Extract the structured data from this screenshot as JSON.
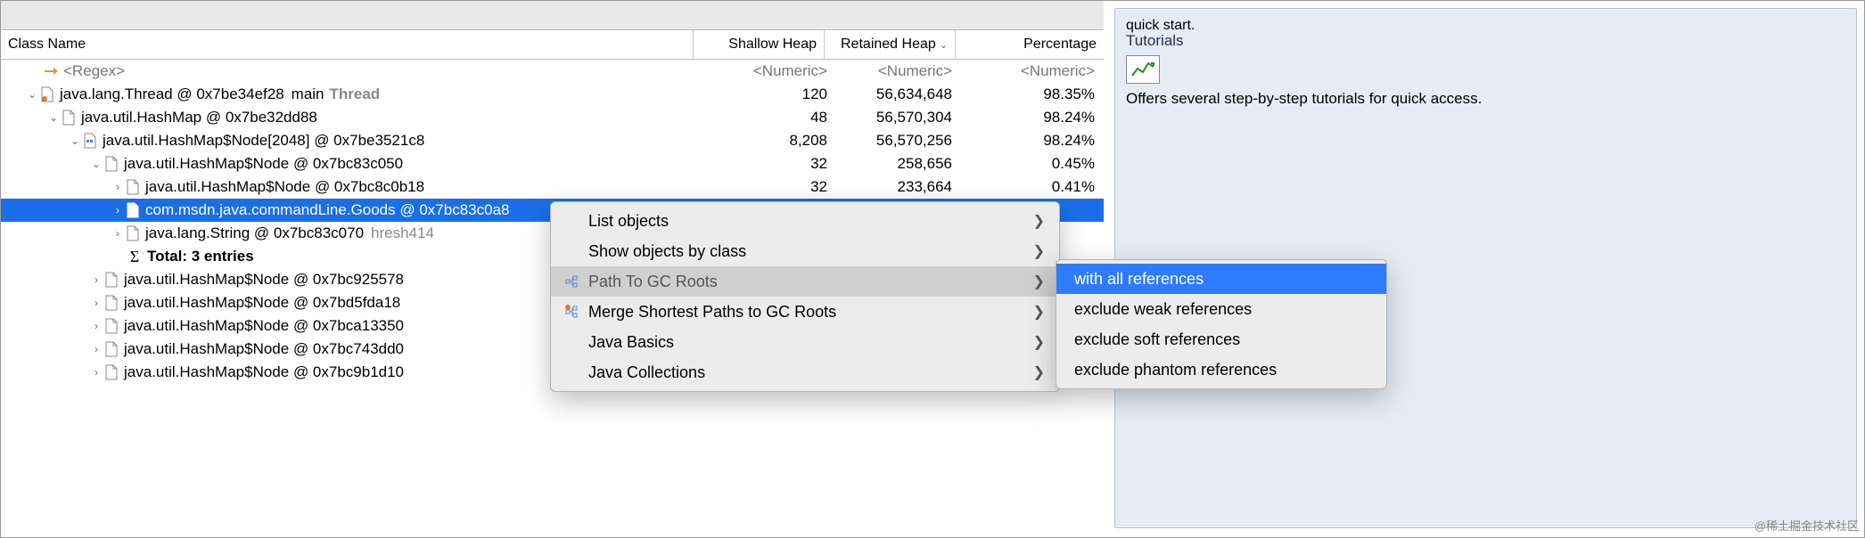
{
  "header": {
    "class_name": "Class Name",
    "shallow": "Shallow Heap",
    "retained": "Retained Heap",
    "percentage": "Percentage",
    "numeric_ph": "<Numeric>",
    "regex_ph": "<Regex>"
  },
  "rows": [
    {
      "indent": 0,
      "tw": "down",
      "icon": "thread",
      "name": "java.lang.Thread @ 0x7be34ef28",
      "extra": "main",
      "extra2": "Thread",
      "sh": "120",
      "rh": "56,634,648",
      "pct": "98.35%"
    },
    {
      "indent": 1,
      "tw": "down",
      "icon": "file",
      "name": "java.util.HashMap @ 0x7be32dd88",
      "sh": "48",
      "rh": "56,570,304",
      "pct": "98.24%"
    },
    {
      "indent": 2,
      "tw": "down",
      "icon": "arrfile",
      "name": "java.util.HashMap$Node[2048] @ 0x7be3521c8",
      "sh": "8,208",
      "rh": "56,570,256",
      "pct": "98.24%"
    },
    {
      "indent": 3,
      "tw": "down",
      "icon": "file",
      "name": "java.util.HashMap$Node @ 0x7bc83c050",
      "sh": "32",
      "rh": "258,656",
      "pct": "0.45%"
    },
    {
      "indent": 4,
      "tw": "right",
      "icon": "file",
      "name": "java.util.HashMap$Node @ 0x7bc8c0b18",
      "sh": "32",
      "rh": "233,664",
      "pct": "0.41%"
    },
    {
      "indent": 4,
      "tw": "right",
      "icon": "file",
      "name": "com.msdn.java.commandLine.Goods @ 0x7bc83c0a8",
      "sel": true
    },
    {
      "indent": 4,
      "tw": "right",
      "icon": "file",
      "name": "java.lang.String @ 0x7bc83c070",
      "extra": "hresh414"
    },
    {
      "indent": 4,
      "tw": "none",
      "icon": "sigma",
      "name": "Total: 3 entries",
      "bold": true
    },
    {
      "indent": 3,
      "tw": "right",
      "icon": "file",
      "name": "java.util.HashMap$Node @ 0x7bc925578"
    },
    {
      "indent": 3,
      "tw": "right",
      "icon": "file",
      "name": "java.util.HashMap$Node @ 0x7bd5fda18"
    },
    {
      "indent": 3,
      "tw": "right",
      "icon": "file",
      "name": "java.util.HashMap$Node @ 0x7bca13350"
    },
    {
      "indent": 3,
      "tw": "right",
      "icon": "file",
      "name": "java.util.HashMap$Node @ 0x7bc743dd0"
    },
    {
      "indent": 3,
      "tw": "right",
      "icon": "file",
      "name": "java.util.HashMap$Node @ 0x7bc9b1d10"
    }
  ],
  "menu1": [
    {
      "label": "List objects",
      "arrow": true
    },
    {
      "label": "Show objects by class",
      "arrow": true
    },
    {
      "label": "Path To GC Roots",
      "arrow": true,
      "icon": "tree",
      "sel": true
    },
    {
      "label": "Merge Shortest Paths to GC Roots",
      "arrow": true,
      "icon": "tree2"
    },
    {
      "label": "Java Basics",
      "arrow": true
    },
    {
      "label": "Java Collections",
      "arrow": true
    }
  ],
  "menu2": [
    {
      "label": "with all references",
      "sel": true
    },
    {
      "label": "exclude weak references"
    },
    {
      "label": "exclude soft references"
    },
    {
      "label": "exclude phantom references"
    }
  ],
  "side": {
    "quick": "quick start.",
    "title": "Tutorials",
    "text": "Offers several step-by-step tutorials for quick access."
  },
  "watermark": "@稀土掘金技术社区"
}
